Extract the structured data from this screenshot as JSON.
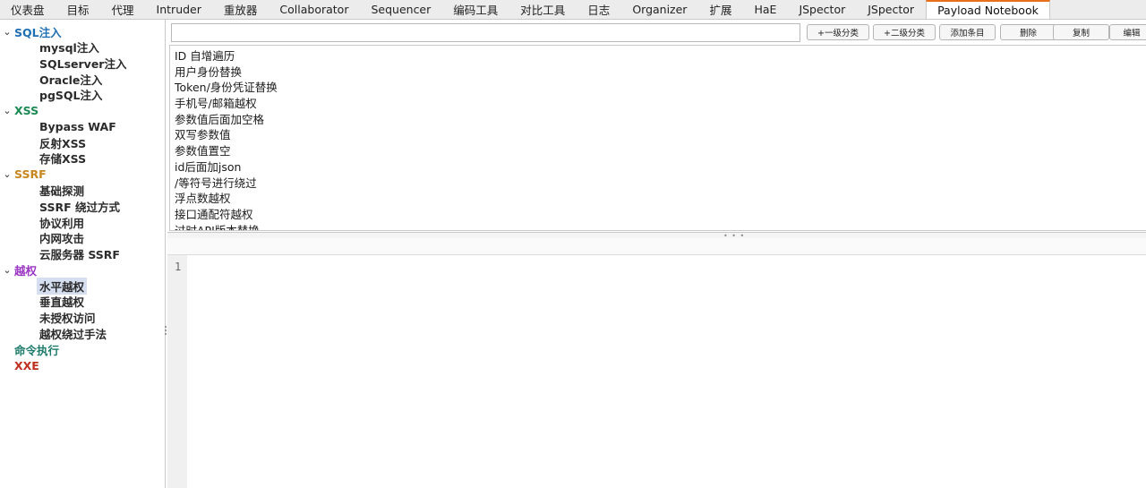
{
  "tabs": [
    {
      "label": "仪表盘",
      "active": false
    },
    {
      "label": "目标",
      "active": false
    },
    {
      "label": "代理",
      "active": false
    },
    {
      "label": "Intruder",
      "active": false
    },
    {
      "label": "重放器",
      "active": false
    },
    {
      "label": "Collaborator",
      "active": false
    },
    {
      "label": "Sequencer",
      "active": false
    },
    {
      "label": "编码工具",
      "active": false
    },
    {
      "label": "对比工具",
      "active": false
    },
    {
      "label": "日志",
      "active": false
    },
    {
      "label": "Organizer",
      "active": false
    },
    {
      "label": "扩展",
      "active": false
    },
    {
      "label": "HaE",
      "active": false
    },
    {
      "label": "JSpector",
      "active": false
    },
    {
      "label": "JSpector",
      "active": false
    },
    {
      "label": "Payload Notebook",
      "active": true
    }
  ],
  "tree": [
    {
      "label": "SQL注入",
      "color": "#1f6fb5",
      "expanded": true,
      "items": [
        "mysql注入",
        "SQLserver注入",
        "Oracle注入",
        "pgSQL注入"
      ]
    },
    {
      "label": "XSS",
      "color": "#1a8a52",
      "expanded": true,
      "items": [
        "Bypass WAF",
        "反射XSS",
        "存储XSS"
      ]
    },
    {
      "label": "SSRF",
      "color": "#c8861e",
      "expanded": true,
      "items": [
        "基础探测",
        "SSRF 绕过方式",
        "协议利用",
        "内网攻击",
        "云服务器 SSRF"
      ]
    },
    {
      "label": "越权",
      "color": "#9b36c4",
      "expanded": true,
      "items": [
        "水平越权",
        "垂直越权",
        "未授权访问",
        "越权绕过手法"
      ]
    },
    {
      "label": "命令执行",
      "color": "#1c7a6a",
      "expanded": false,
      "items": []
    },
    {
      "label": "XXE",
      "color": "#c0301e",
      "expanded": false,
      "items": []
    }
  ],
  "selected_item": "水平越权",
  "search": {
    "value": "",
    "placeholder": ""
  },
  "buttons": [
    "+一级分类",
    "+二级分类",
    "添加条目",
    "删除",
    "复制",
    "编辑"
  ],
  "list_items": [
    "ID 自增遍历",
    "用户身份替换",
    "Token/身份凭证替换",
    "手机号/邮箱越权",
    "参数值后面加空格",
    "双写参数值",
    "参数值置空",
    "id后面加json",
    "/等符号进行绕过",
    "浮点数越权",
    "接口通配符越权",
    "过时API版本替换"
  ],
  "editor": {
    "line_number": "1",
    "content": ""
  },
  "colors": {
    "accent": "#e8701a",
    "selection": "#d6dff0"
  }
}
